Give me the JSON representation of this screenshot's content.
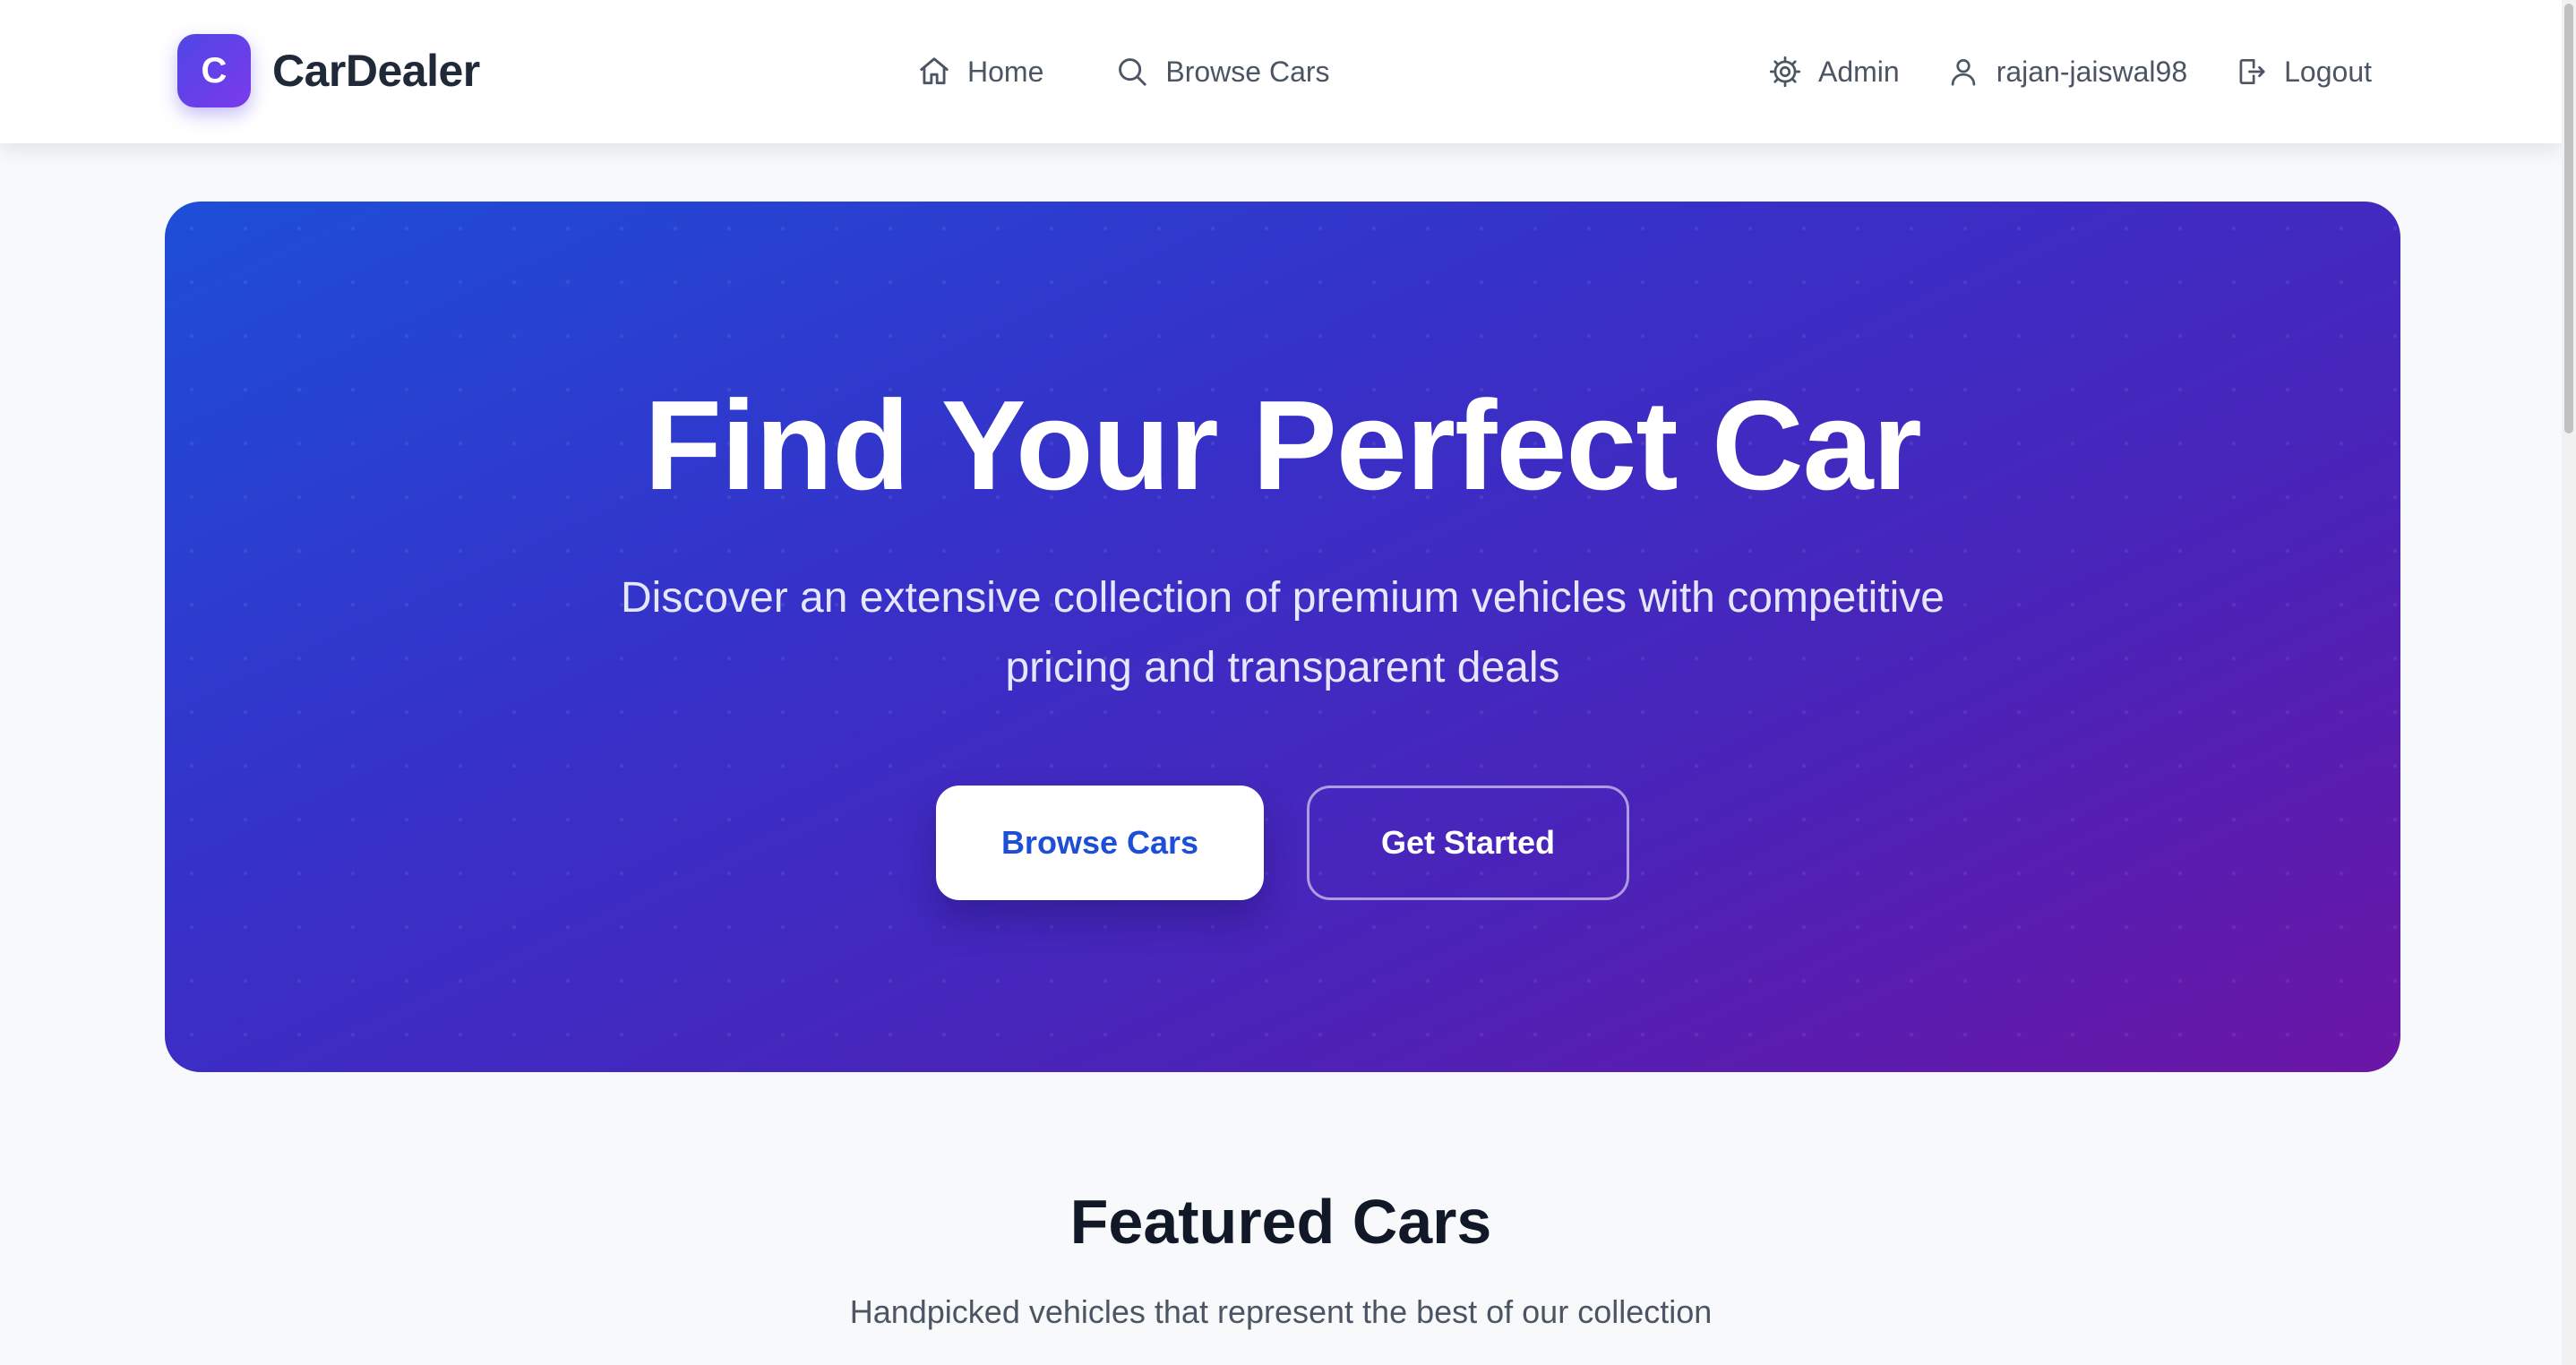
{
  "brand": {
    "logo_letter": "C",
    "name": "CarDealer",
    "logo_gradient": [
      "#4f46e5",
      "#7c3aed"
    ]
  },
  "nav": {
    "center": [
      {
        "label": "Home",
        "icon": "home-icon"
      },
      {
        "label": "Browse Cars",
        "icon": "search-icon"
      }
    ],
    "right": [
      {
        "label": "Admin",
        "icon": "gear-icon"
      },
      {
        "label": "rajan-jaiswal98",
        "icon": "user-icon"
      },
      {
        "label": "Logout",
        "icon": "logout-icon"
      }
    ]
  },
  "hero": {
    "title": "Find Your Perfect Car",
    "subtitle": "Discover an extensive collection of premium vehicles with competitive pricing and transparent deals",
    "primary_button": "Browse Cars",
    "secondary_button": "Get Started",
    "gradient": [
      "#1d4ed8",
      "#3730c8",
      "#4c23b8",
      "#6b16a6"
    ]
  },
  "featured": {
    "title": "Featured Cars",
    "subtitle": "Handpicked vehicles that represent the best of our collection"
  },
  "colors": {
    "accent": "#1d4ed8",
    "page_background": "#f8f9fb",
    "nav_text": "#4b5563"
  }
}
